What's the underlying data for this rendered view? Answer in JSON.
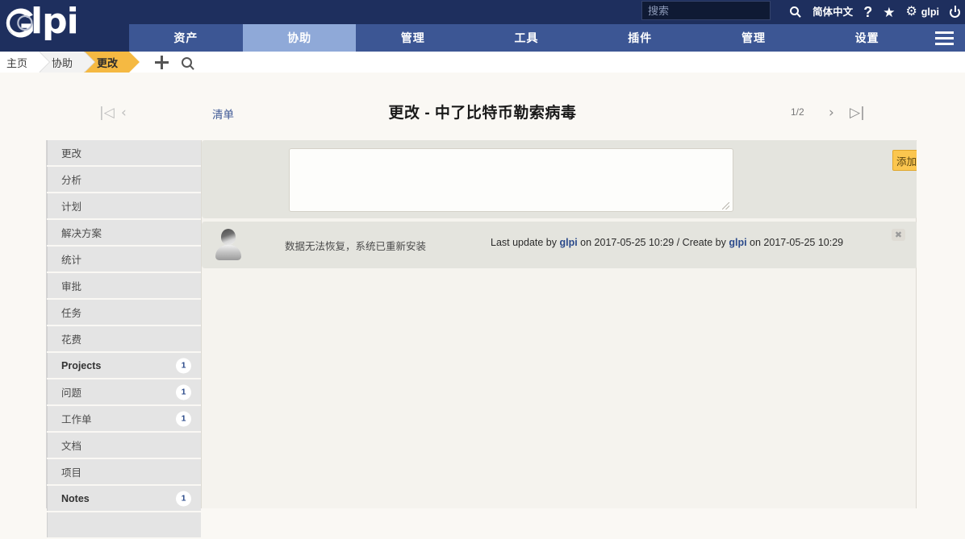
{
  "header": {
    "search": {
      "placeholder": "搜索",
      "value": ""
    },
    "language": "简体中文",
    "help": "?",
    "star": "★",
    "gear": "⚙",
    "user": "glpi",
    "power": "power-icon"
  },
  "logo": {
    "text": "lpi"
  },
  "nav": {
    "items": [
      {
        "label": "资产",
        "active": false
      },
      {
        "label": "协助",
        "active": true
      },
      {
        "label": "管理",
        "active": false
      },
      {
        "label": "工具",
        "active": false
      },
      {
        "label": "插件",
        "active": false
      },
      {
        "label": "管理",
        "active": false
      },
      {
        "label": "设置",
        "active": false
      }
    ]
  },
  "breadcrumb": {
    "items": [
      "主页",
      "协助",
      "更改"
    ]
  },
  "title_row": {
    "list_link": "清单",
    "title": "更改 - 中了比特币勒索病毒",
    "page_count": "1/2",
    "first": "|◁",
    "prev": "‹",
    "next": "›",
    "last": "▷|"
  },
  "sidebar": {
    "items": [
      {
        "label": "更改",
        "badge": "",
        "bold": false
      },
      {
        "label": "分析",
        "badge": "",
        "bold": false
      },
      {
        "label": "计划",
        "badge": "",
        "bold": false
      },
      {
        "label": "解决方案",
        "badge": "",
        "bold": false
      },
      {
        "label": "统计",
        "badge": "",
        "bold": false
      },
      {
        "label": "审批",
        "badge": "",
        "bold": false
      },
      {
        "label": "任务",
        "badge": "",
        "bold": false
      },
      {
        "label": "花费",
        "badge": "",
        "bold": false
      },
      {
        "label": "Projects",
        "badge": "1",
        "bold": true
      },
      {
        "label": "问题",
        "badge": "1",
        "bold": false
      },
      {
        "label": "工作单",
        "badge": "1",
        "bold": false
      },
      {
        "label": "文档",
        "badge": "",
        "bold": false
      },
      {
        "label": "项目",
        "badge": "",
        "bold": false
      },
      {
        "label": "Notes",
        "badge": "1",
        "bold": true
      },
      {
        "label": "",
        "badge": "",
        "bold": false
      }
    ]
  },
  "content": {
    "compose": {
      "value": "",
      "placeholder": "",
      "add_label": "添加"
    },
    "note": {
      "text": "数据无法恢复，系统已重新安装",
      "meta_prefix": "Last update by ",
      "meta_user1": "glpi",
      "meta_mid": " on 2017-05-25 10:29 / Create by ",
      "meta_user2": "glpi",
      "meta_suffix": " on 2017-05-25 10:29",
      "close": "✖"
    }
  },
  "colors": {
    "topbar": "#1e2f5e",
    "nav": "#3c5694",
    "nav_active": "#8fa9d8",
    "crumb_active": "#f5b942",
    "add_button": "#fbc64f",
    "link": "#3c5694",
    "page_bg": "#faf8f4",
    "panel": "#f5f3ee",
    "card": "#e4e4de",
    "sidebar_item": "#e4e4e4"
  }
}
